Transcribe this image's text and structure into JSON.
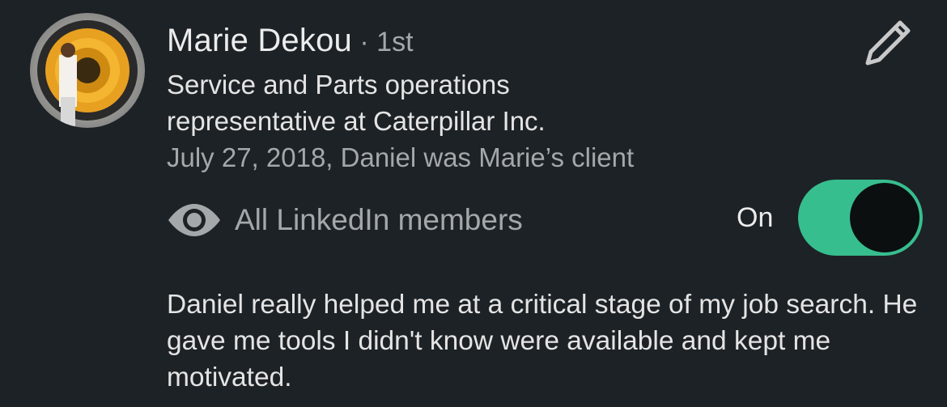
{
  "recommendation": {
    "name": "Marie Dekou",
    "degree": " · 1st",
    "headline": "Service and Parts operations representative  at Caterpillar Inc.",
    "relationship": "July 27, 2018, Daniel was Marie’s client",
    "visibility_label": "All LinkedIn members",
    "toggle_state_label": "On",
    "toggle_on": true,
    "text": "Daniel really helped me at a critical stage of my job search. He gave me tools I didn't know were available and kept me motivated."
  },
  "icons": {
    "edit": "pencil-icon",
    "visibility": "eye-icon"
  },
  "colors": {
    "background": "#1d2226",
    "toggle_on": "#37be8e",
    "secondary_text": "#a4a8ab"
  }
}
